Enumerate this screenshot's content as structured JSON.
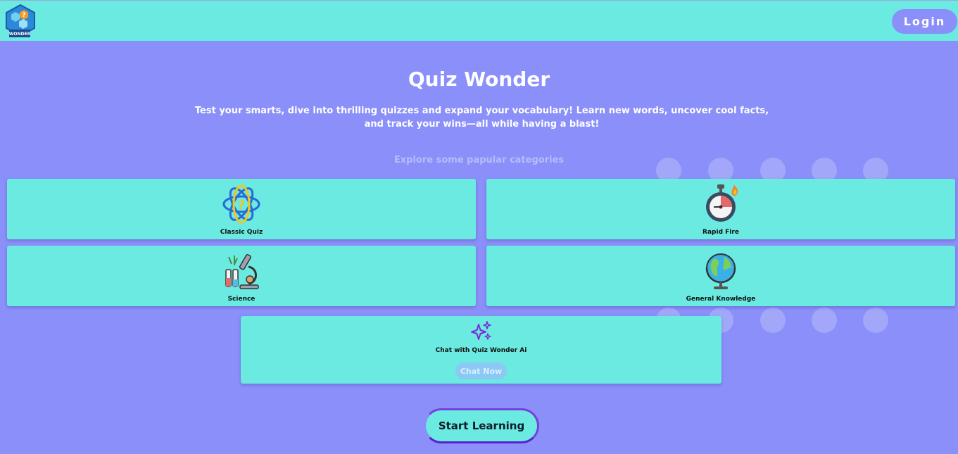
{
  "header": {
    "logo_text": "WONDER",
    "login_label": "Login"
  },
  "hero": {
    "title": "Quiz Wonder",
    "subtitle": "Test your smarts, dive into thrilling quizzes and expand your vocabulary! Learn new words, uncover cool facts, and track your wins—all while having a blast!",
    "explore_label": "Explore some papular categories"
  },
  "categories": [
    {
      "label": "Classic Quiz",
      "icon": "atom-question-icon"
    },
    {
      "label": "Rapid Fire",
      "icon": "stopwatch-fire-icon"
    },
    {
      "label": "Science",
      "icon": "microscope-lab-icon"
    },
    {
      "label": "General Knowledge",
      "icon": "globe-icon"
    }
  ],
  "ai_card": {
    "label": "Chat with Quiz Wonder Ai",
    "button_label": "Chat Now",
    "icon": "sparkles-icon"
  },
  "start_button_label": "Start Learning",
  "colors": {
    "background": "#8a8ff9",
    "header": "#6aeae0",
    "card": "#6aeae0",
    "accent_purple": "#7a3ee0"
  }
}
